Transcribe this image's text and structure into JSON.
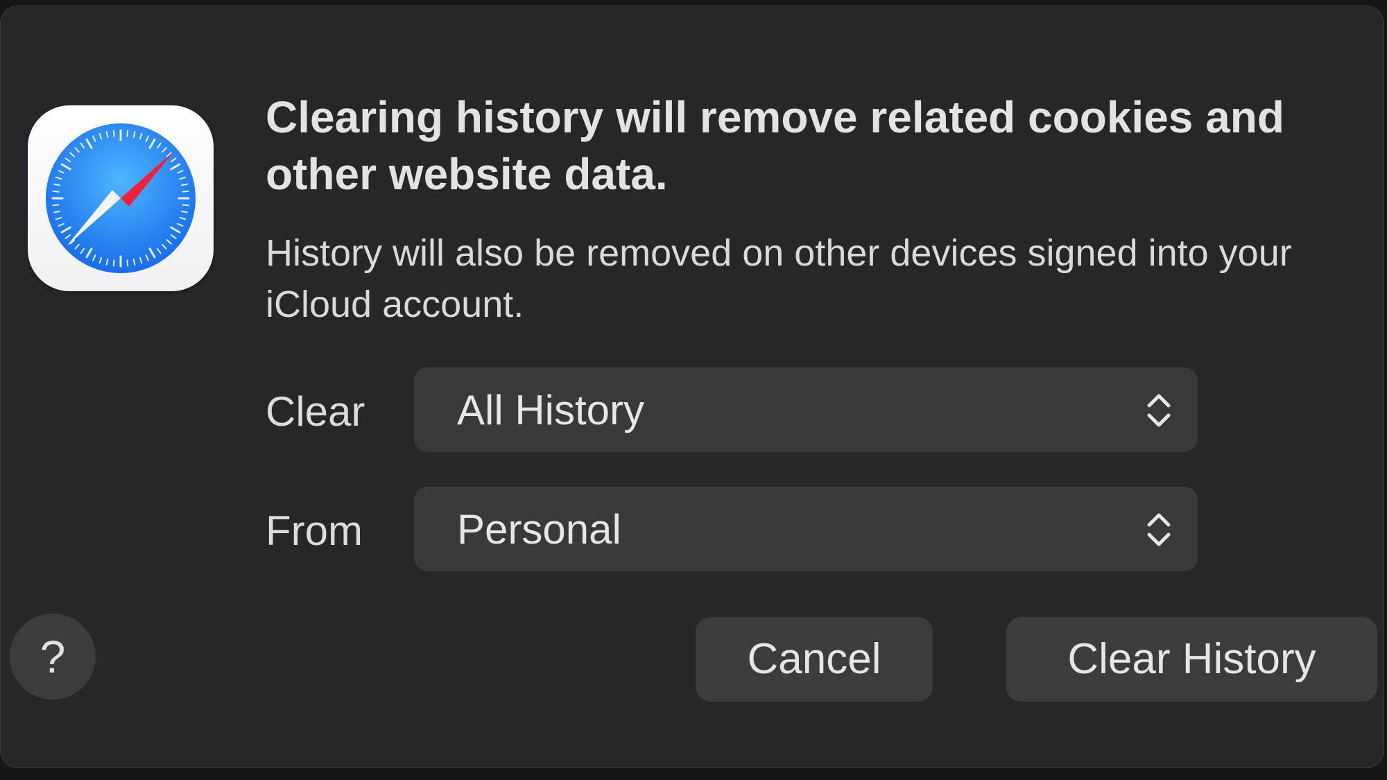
{
  "dialog": {
    "title": "Clearing history will remove related cookies and other website data.",
    "message": "History will also be removed on other devices signed into your iCloud account.",
    "app_icon": "safari-compass-icon",
    "fields": {
      "clear": {
        "label": "Clear",
        "selected": "All History",
        "icon": "chevron-up-down-icon"
      },
      "from": {
        "label": "From",
        "selected": "Personal",
        "icon": "chevron-up-down-icon"
      }
    },
    "help_label": "?",
    "buttons": {
      "cancel": "Cancel",
      "confirm": "Clear History"
    }
  },
  "colors": {
    "dialog_background": "#25272a",
    "control_background": "#37393c",
    "button_background": "#3a3c3f",
    "text_primary": "#e3e3e5",
    "compass_blue": "#1f8cf5",
    "needle_red": "#f0203a"
  }
}
